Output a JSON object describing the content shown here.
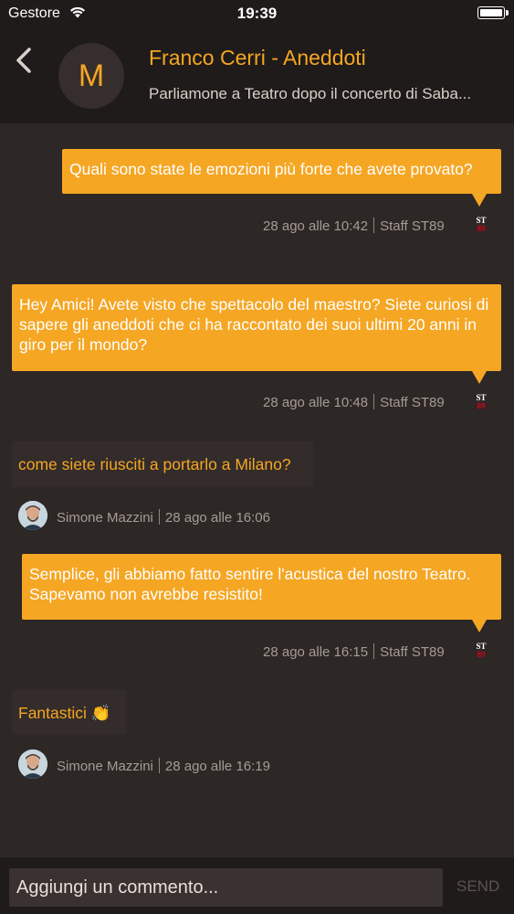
{
  "status_bar": {
    "carrier": "Gestore",
    "time": "19:39"
  },
  "header": {
    "avatar_letter": "M",
    "title": "Franco Cerri - Aneddoti",
    "subtitle": "Parliamone a Teatro dopo il concerto di Saba..."
  },
  "staff_logo": {
    "line1": "ST",
    "line2": "89"
  },
  "messages": [
    {
      "text": "Quali sono state le emozioni più forte che avete provato?",
      "time": "28 ago alle 10:42",
      "author": "Staff ST89"
    },
    {
      "text": "Hey Amici! Avete visto che spettacolo del maestro? Siete curiosi di sapere gli aneddoti che ci ha raccontato dei suoi ultimi 20 anni in giro per il mondo?",
      "time": "28 ago alle 10:48",
      "author": "Staff ST89"
    },
    {
      "text": "come siete riusciti a portarlo a Milano?",
      "author": "Simone Mazzini",
      "time": "28 ago alle 16:06"
    },
    {
      "text": "Semplice, gli abbiamo fatto sentire l'acustica del nostro Teatro. Sapevamo non avrebbe resistito!",
      "time": "28 ago alle 16:15",
      "author": "Staff ST89"
    },
    {
      "text": "Fantastici 👏",
      "author": "Simone Mazzini",
      "time": "28 ago alle 16:19"
    }
  ],
  "composer": {
    "placeholder": "Aggiungi un commento...",
    "send_label": "SEND"
  },
  "colors": {
    "accent": "#f5a623",
    "background": "#2d2726",
    "header": "#1f1b1a",
    "incoming_bubble": "#332c2a"
  }
}
